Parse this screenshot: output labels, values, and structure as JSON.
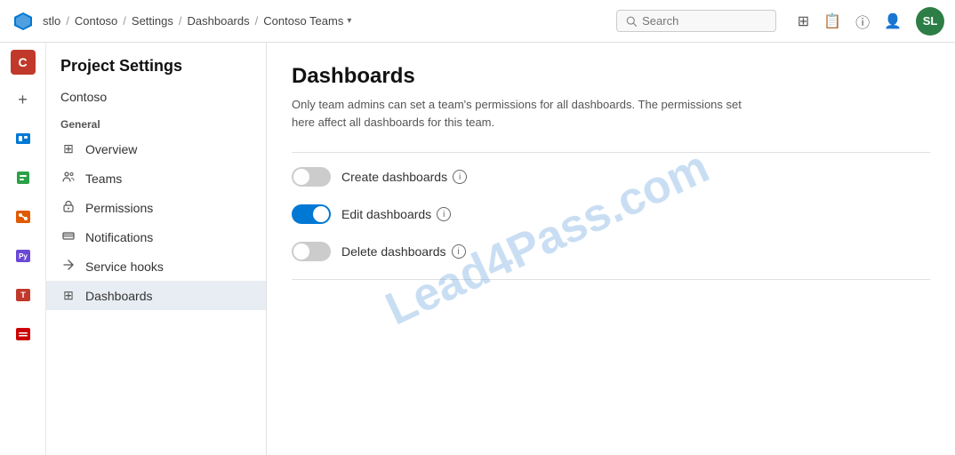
{
  "topnav": {
    "breadcrumb": {
      "parts": [
        "stlo",
        "Contoso",
        "Settings",
        "Dashboards",
        "Contoso Teams"
      ]
    },
    "search_placeholder": "Search",
    "user_initials": "SL",
    "user_avatar_bg": "#2d7d46"
  },
  "icon_bar": {
    "c_label": "C",
    "plus_label": "+"
  },
  "sidebar": {
    "title": "Project Settings",
    "org_name": "Contoso",
    "section_general": "General",
    "items": [
      {
        "id": "overview",
        "label": "Overview",
        "icon": "⊞"
      },
      {
        "id": "teams",
        "label": "Teams",
        "icon": "⚙"
      },
      {
        "id": "permissions",
        "label": "Permissions",
        "icon": "🔒"
      },
      {
        "id": "notifications",
        "label": "Notifications",
        "icon": "☰"
      },
      {
        "id": "service-hooks",
        "label": "Service hooks",
        "icon": "⚡"
      },
      {
        "id": "dashboards",
        "label": "Dashboards",
        "icon": "⊞"
      }
    ]
  },
  "content": {
    "title": "Dashboards",
    "description": "Only team admins can set a team's permissions for all dashboards. The permissions set here affect all dashboards for this team.",
    "toggles": [
      {
        "id": "create",
        "label": "Create dashboards",
        "state": "off"
      },
      {
        "id": "edit",
        "label": "Edit dashboards",
        "state": "on"
      },
      {
        "id": "delete",
        "label": "Delete dashboards",
        "state": "off"
      }
    ]
  },
  "watermark": "Lead4Pass.com"
}
